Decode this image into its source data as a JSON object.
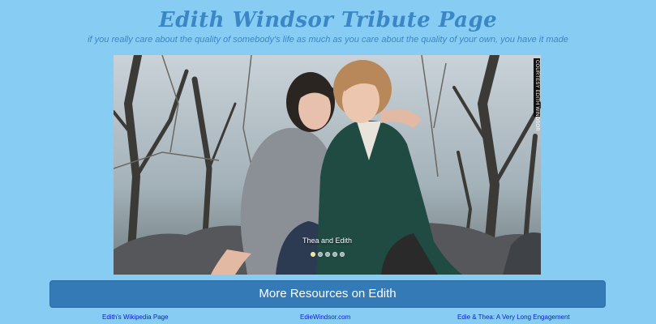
{
  "header": {
    "title": "Edith Windsor Tribute Page",
    "quote": "if you really care about the quality of somebody's life as much as you care about the quality of your own, you have it made"
  },
  "carousel": {
    "image_credit": "COURTESY EDITH WINDSOR",
    "caption": "Thea and Edith",
    "slide_count": 5,
    "active_slide": 1
  },
  "resources": {
    "button_label": "More Resources on Edith",
    "links": [
      {
        "label": "Edith's Wikipedia Page"
      },
      {
        "label": "EdieWindsor.com"
      },
      {
        "label": "Edie & Thea: A Very Long Engagement"
      }
    ]
  },
  "colors": {
    "background": "#87cdf3",
    "title": "#3a86c6",
    "button": "#337ab7",
    "link": "#0b1fc8"
  }
}
